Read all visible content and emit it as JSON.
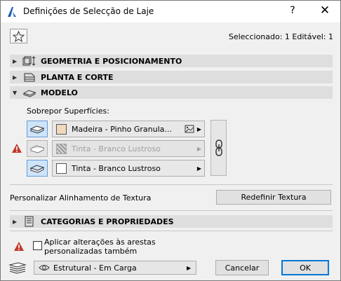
{
  "window": {
    "title": "Definições de Selecção de Laje",
    "help_label": "?",
    "close_label": "✕"
  },
  "header": {
    "selection_status": "Seleccionado: 1 Editável: 1"
  },
  "sections": {
    "geometry": "GEOMETRIA E POSICIONAMENTO",
    "plan": "PLANTA E CORTE",
    "model": "MODELO",
    "categories": "CATEGORIAS E PROPRIEDADES"
  },
  "model": {
    "override_label": "Sobrepor Superfícies:",
    "materials": [
      {
        "name": "Madeira - Pinho Granula...",
        "swatch": "#f2d9bd",
        "enabled": true
      },
      {
        "name": "Tinta - Branco Lustroso",
        "swatch": "hatched",
        "enabled": false
      },
      {
        "name": "Tinta - Branco Lustroso",
        "swatch": "#ffffff",
        "enabled": true
      }
    ],
    "texture_align_label": "Personalizar Alinhamento de Textura",
    "reset_texture_label": "Redefinir Textura"
  },
  "footer": {
    "apply_edges_label": "Aplicar alterações às arestas personalizadas também",
    "apply_edges_checked": false,
    "layer_value": "Estrutural - Em Carga",
    "cancel_label": "Cancelar",
    "ok_label": "OK"
  },
  "colors": {
    "section_bg": "#dedede",
    "active_btn_bg": "#cde4f9",
    "accent": "#0078d7",
    "warning": "#c0392b"
  }
}
